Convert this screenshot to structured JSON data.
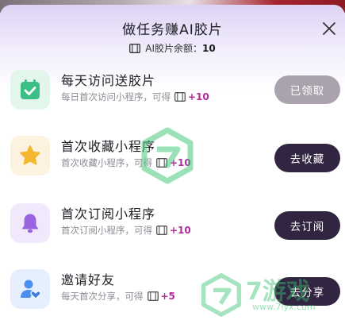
{
  "dialog": {
    "title": "做任务赚AI胶片",
    "balance_label": "AI胶片余额：",
    "balance_value": "10"
  },
  "tasks": [
    {
      "title": "每天访问送胶片",
      "subtitle": "每日首次访问小程序，可得",
      "reward": "+10",
      "button": "已领取",
      "icon": "calendar-check-icon",
      "done": true
    },
    {
      "title": "首次收藏小程序",
      "subtitle": "首次收藏小程序，可得",
      "reward": "+10",
      "button": "去收藏",
      "icon": "star-icon",
      "done": false
    },
    {
      "title": "首次订阅小程序",
      "subtitle": "首次订阅小程序，可得",
      "reward": "+10",
      "button": "去订阅",
      "icon": "bell-icon",
      "done": false
    },
    {
      "title": "邀请好友",
      "subtitle": "每天首次分享，可得",
      "reward": "+5",
      "button": "去分享",
      "icon": "user-heart-icon",
      "done": false
    }
  ],
  "watermark": {
    "text": "7游戏",
    "url": "www.7lyx.com"
  },
  "colors": {
    "dark_button": "#322541",
    "done_button": "#aaa3ae",
    "reward": "#b12b9a"
  }
}
